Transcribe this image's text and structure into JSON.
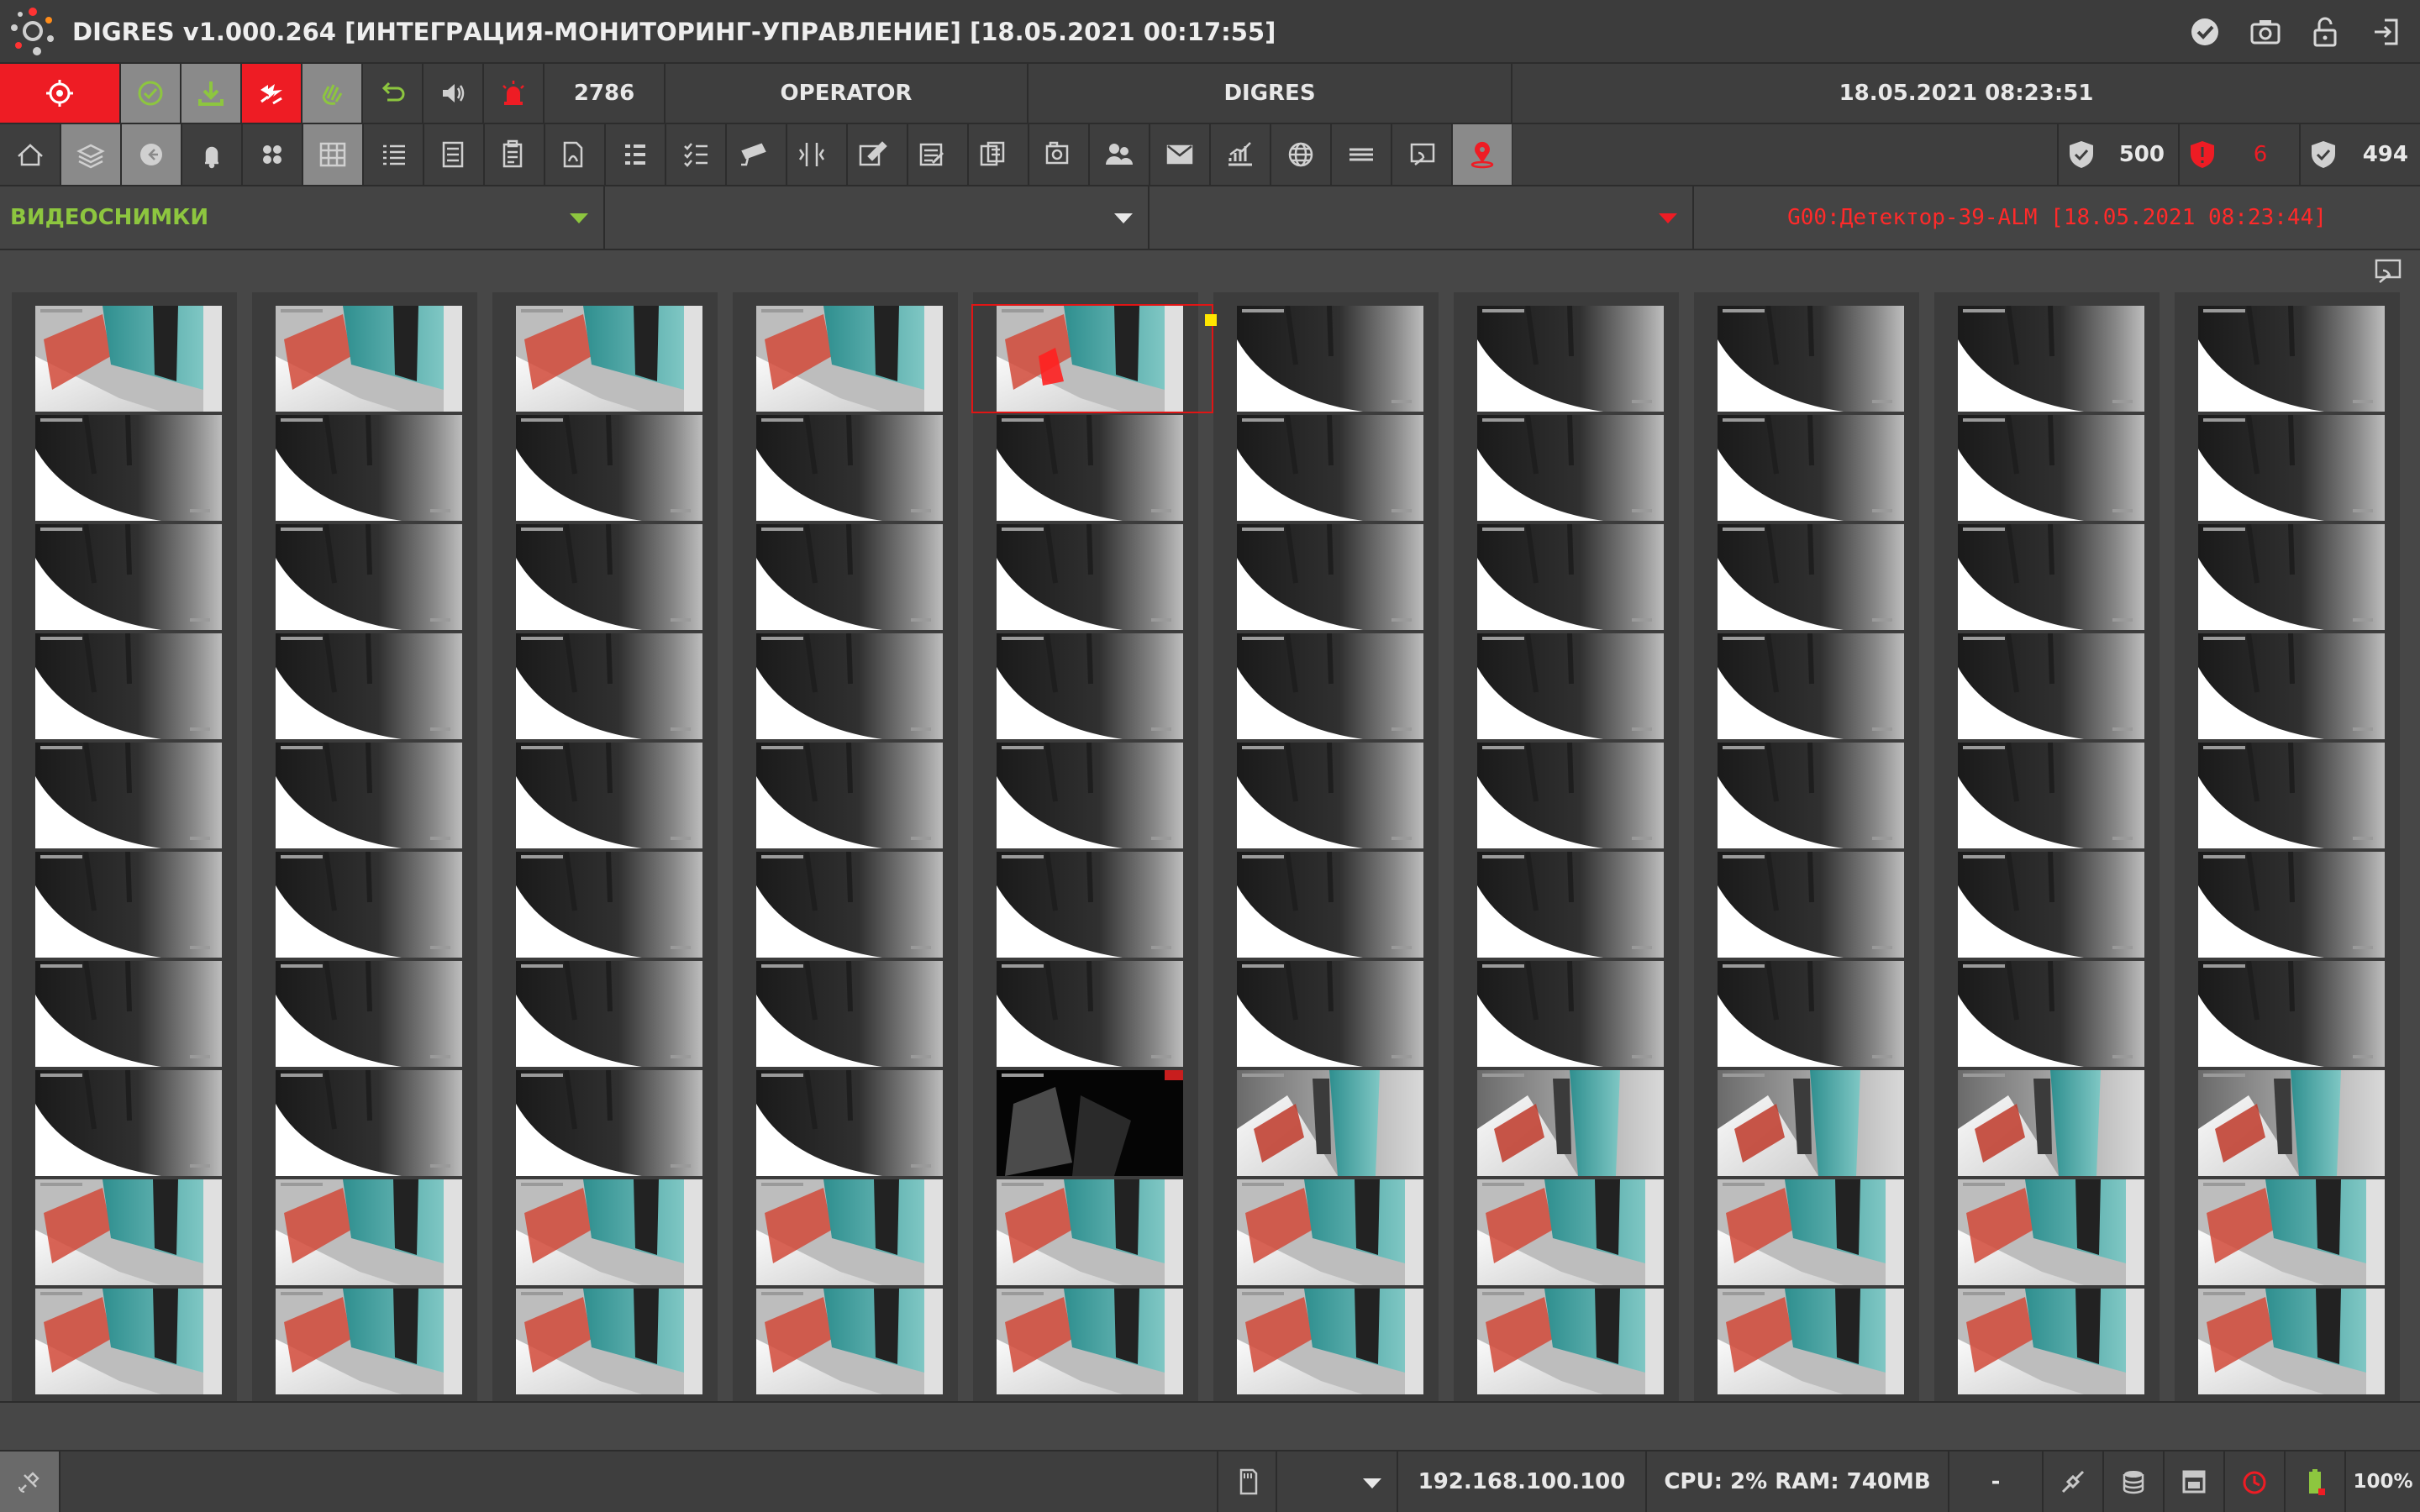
{
  "window": {
    "title": "DIGRES v1.000.264 [ИНТЕГРАЦИЯ-МОНИТОРИНГ-УПРАВЛЕНИЕ] [18.05.2021 00:17:55]",
    "title_icons": [
      "check-circle-icon",
      "camera-icon",
      "unlock-icon",
      "exit-icon"
    ]
  },
  "topbar": {
    "counter": "2786",
    "user": "OPERATOR",
    "server": "DIGRES",
    "datetime": "18.05.2021 08:23:51",
    "buttons": [
      "alarm-target-icon",
      "check-circle-icon",
      "download-icon",
      "lightning-icon",
      "hand-icon",
      "undo-icon",
      "speaker-icon",
      "siren-icon"
    ]
  },
  "toolbar": {
    "buttons": [
      "home-icon",
      "layers-icon",
      "back-icon",
      "bell-icon",
      "grid4-icon",
      "grid9-icon",
      "list-icon",
      "cards-icon",
      "clipboard-icon",
      "pdf-icon",
      "list-numbered-icon",
      "checklist-icon",
      "camera-cctv-icon",
      "door-icon",
      "edit-icon",
      "report-icon",
      "documents-icon",
      "photo-icon",
      "users-icon",
      "mail-icon",
      "chart-icon",
      "globe-icon",
      "lines-icon",
      "screen-icon",
      "location-pin-icon"
    ],
    "shield_counts": [
      "500",
      "6",
      "494"
    ]
  },
  "filterbar": {
    "mode": "ВИДЕОСНИМКИ",
    "filter2": "",
    "filter3": "",
    "event": "G00:Детектор-39-ALM [18.05.2021 08:23:44]"
  },
  "colors": {
    "accent_green": "#8dc63f",
    "alarm_red": "#ff2a2a",
    "bg": "#474747"
  },
  "grid": {
    "columns": 10,
    "rows": 10,
    "scenes": [
      [
        "teal",
        "teal",
        "teal",
        "teal",
        "teal-alarm",
        "dark",
        "dark",
        "dark",
        "dark",
        "dark"
      ],
      [
        "dark",
        "dark",
        "dark",
        "dark",
        "dark",
        "dark",
        "dark",
        "dark",
        "dark",
        "dark"
      ],
      [
        "dark",
        "dark",
        "dark",
        "dark",
        "dark",
        "dark",
        "dark",
        "dark",
        "dark",
        "dark"
      ],
      [
        "dark",
        "dark",
        "dark",
        "dark",
        "dark",
        "dark",
        "dark",
        "dark",
        "dark",
        "dark"
      ],
      [
        "dark",
        "dark",
        "dark",
        "dark",
        "dark",
        "dark",
        "dark",
        "dark",
        "dark",
        "dark"
      ],
      [
        "dark",
        "dark",
        "dark",
        "dark",
        "dark",
        "dark",
        "dark",
        "dark",
        "dark",
        "dark"
      ],
      [
        "dark",
        "dark",
        "dark",
        "dark",
        "dark",
        "dark",
        "dark",
        "dark",
        "dark",
        "dark"
      ],
      [
        "dark",
        "dark",
        "dark",
        "dark",
        "night",
        "teal-bright",
        "teal-bright",
        "teal-bright",
        "teal-bright",
        "teal-bright"
      ],
      [
        "teal",
        "teal",
        "teal",
        "teal",
        "teal",
        "teal",
        "teal",
        "teal",
        "teal",
        "teal"
      ],
      [
        "teal",
        "teal",
        "teal",
        "teal",
        "teal",
        "teal",
        "teal",
        "teal",
        "teal",
        "teal"
      ]
    ]
  },
  "statusbar": {
    "ip": "192.168.100.100",
    "resources": "CPU: 2% RAM: 740MB",
    "dash": "-",
    "zoom": "100%"
  }
}
